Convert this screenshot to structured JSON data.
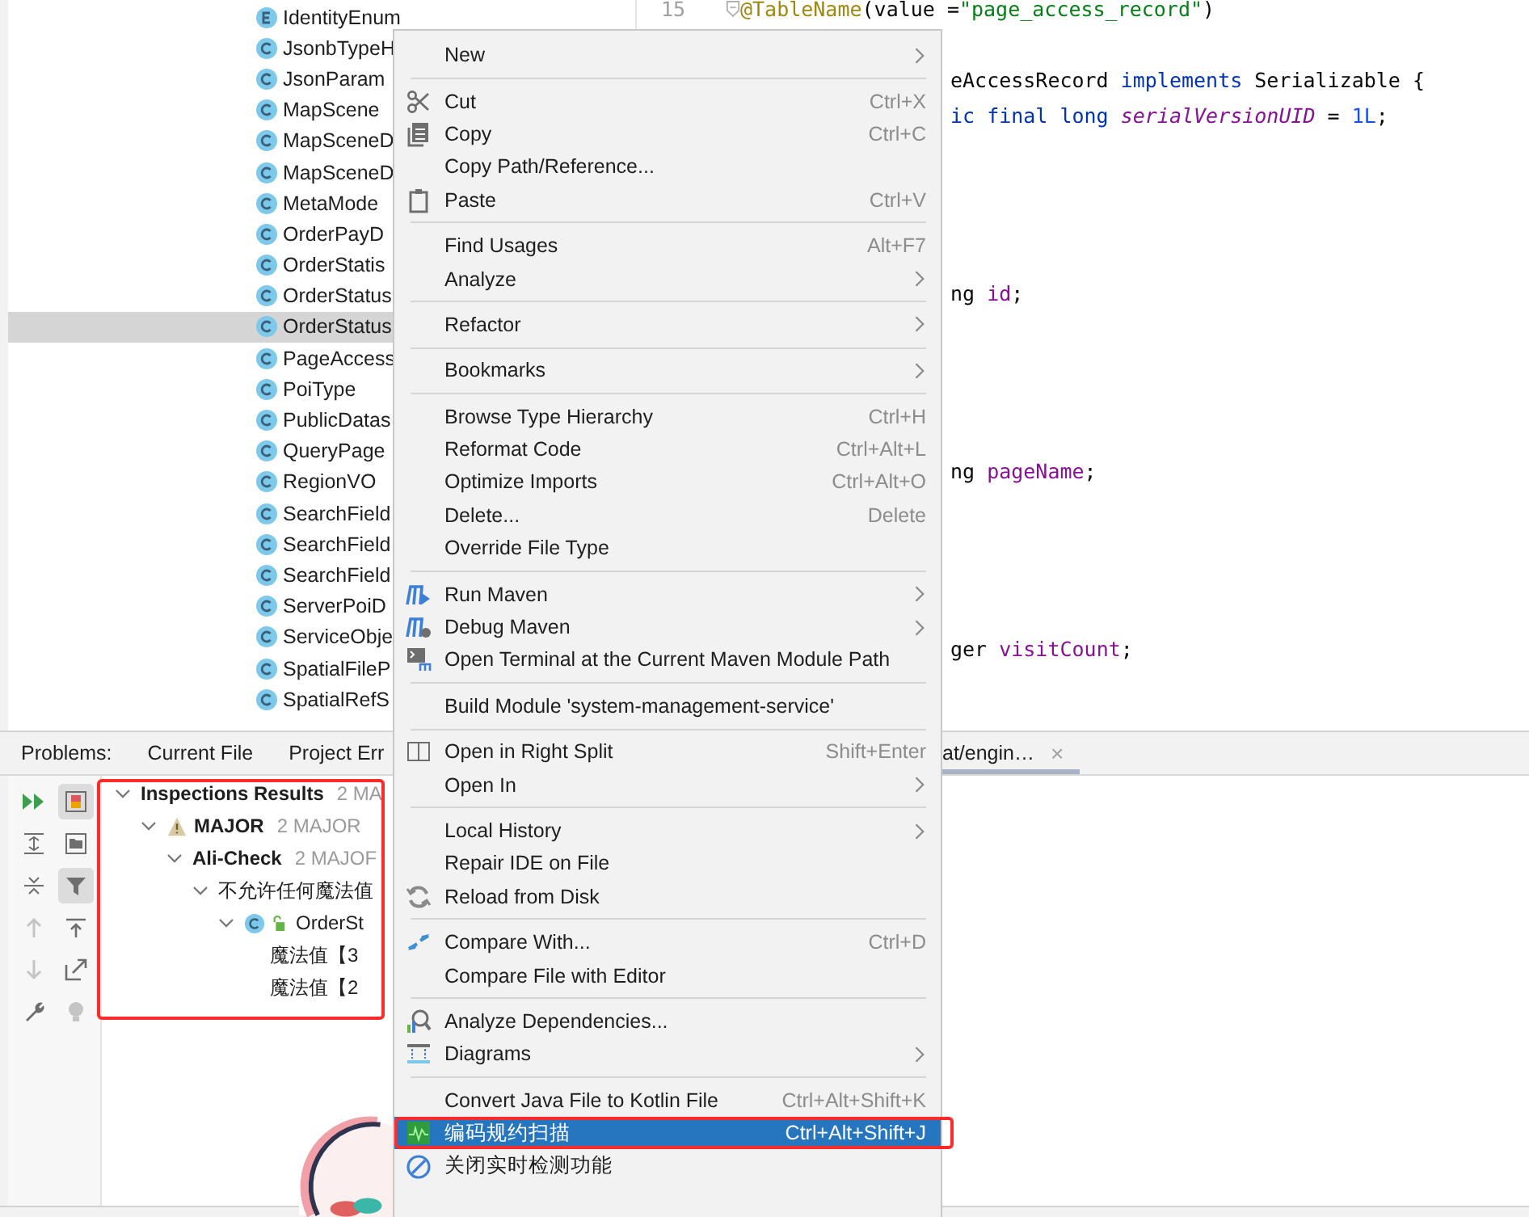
{
  "project_tree": {
    "items": [
      {
        "label": "IdentityEnum",
        "kind": "enum",
        "selected": false
      },
      {
        "label": "JsonbTypeH",
        "kind": "class",
        "selected": false
      },
      {
        "label": "JsonParam",
        "kind": "class",
        "selected": false
      },
      {
        "label": "MapScene",
        "kind": "class",
        "selected": false
      },
      {
        "label": "MapSceneD",
        "kind": "class",
        "selected": false
      },
      {
        "label": "MapSceneD",
        "kind": "class",
        "selected": false
      },
      {
        "label": "MetaMode",
        "kind": "class",
        "selected": false
      },
      {
        "label": "OrderPayD",
        "kind": "class",
        "selected": false
      },
      {
        "label": "OrderStatis",
        "kind": "class",
        "selected": false
      },
      {
        "label": "OrderStatus",
        "kind": "class",
        "selected": false
      },
      {
        "label": "OrderStatus",
        "kind": "class",
        "selected": true
      },
      {
        "label": "PageAccess",
        "kind": "class",
        "selected": false
      },
      {
        "label": "PoiType",
        "kind": "class",
        "selected": false
      },
      {
        "label": "PublicDatas",
        "kind": "class",
        "selected": false
      },
      {
        "label": "QueryPage",
        "kind": "class",
        "selected": false
      },
      {
        "label": "RegionVO",
        "kind": "class",
        "selected": false
      },
      {
        "label": "SearchField",
        "kind": "class",
        "selected": false
      },
      {
        "label": "SearchField",
        "kind": "class",
        "selected": false
      },
      {
        "label": "SearchField",
        "kind": "class",
        "selected": false
      },
      {
        "label": "ServerPoiD",
        "kind": "class",
        "selected": false
      },
      {
        "label": "ServiceObje",
        "kind": "class",
        "selected": false
      },
      {
        "label": "SpatialFileP",
        "kind": "class",
        "selected": false
      },
      {
        "label": "SpatialRefS",
        "kind": "class",
        "selected": false
      }
    ]
  },
  "editor": {
    "lines": [
      {
        "kind": "full",
        "number": "15",
        "tokens": [
          {
            "kind": "annotation",
            "text": "@TableName"
          },
          {
            "kind": "plain",
            "text": "(value ="
          },
          {
            "kind": "string",
            "text": "\"page_access_record\""
          },
          {
            "kind": "plain",
            "text": ")"
          }
        ]
      },
      {
        "kind": "blank"
      },
      {
        "kind": "partial",
        "tokens": [
          {
            "kind": "plain",
            "text": "eAccessRecord "
          },
          {
            "kind": "keyword",
            "text": "implements"
          },
          {
            "kind": "plain",
            "text": " Serializable {"
          }
        ]
      },
      {
        "kind": "partial",
        "tokens": [
          {
            "kind": "keyword",
            "text": "ic final long "
          },
          {
            "kind": "constant",
            "text": "serialVersionUID"
          },
          {
            "kind": "plain",
            "text": " = "
          },
          {
            "kind": "number",
            "text": "1L"
          },
          {
            "kind": "plain",
            "text": ";"
          }
        ]
      },
      {
        "kind": "blank"
      },
      {
        "kind": "blank"
      },
      {
        "kind": "blank"
      },
      {
        "kind": "blank"
      },
      {
        "kind": "partial",
        "tokens": [
          {
            "kind": "plain",
            "text": "ng "
          },
          {
            "kind": "field",
            "text": "id"
          },
          {
            "kind": "plain",
            "text": ";"
          }
        ]
      },
      {
        "kind": "blank"
      },
      {
        "kind": "blank"
      },
      {
        "kind": "blank"
      },
      {
        "kind": "blank"
      },
      {
        "kind": "partial",
        "tokens": [
          {
            "kind": "plain",
            "text": "ng "
          },
          {
            "kind": "field",
            "text": "pageName"
          },
          {
            "kind": "plain",
            "text": ";"
          }
        ]
      },
      {
        "kind": "blank"
      },
      {
        "kind": "blank"
      },
      {
        "kind": "blank"
      },
      {
        "kind": "blank"
      },
      {
        "kind": "partial",
        "tokens": [
          {
            "kind": "plain",
            "text": "ger "
          },
          {
            "kind": "field",
            "text": "visitCount"
          },
          {
            "kind": "plain",
            "text": ";"
          }
        ]
      }
    ]
  },
  "problems_panel": {
    "label": "Problems:",
    "tabs": [
      {
        "label": "Current File",
        "selected": false
      },
      {
        "label": "Project Err",
        "selected": false
      }
    ],
    "open_tab": {
      "label": "at/engin…",
      "selected": true,
      "close": "×"
    },
    "toolbar": [
      {
        "kind": "run",
        "on": false,
        "disabled": false
      },
      {
        "kind": "severity",
        "on": true,
        "disabled": false
      },
      {
        "kind": "expand",
        "on": false,
        "disabled": false
      },
      {
        "kind": "folder",
        "on": false,
        "disabled": false
      },
      {
        "kind": "collapse",
        "on": false,
        "disabled": false
      },
      {
        "kind": "filter",
        "on": true,
        "disabled": false
      },
      {
        "kind": "up",
        "on": false,
        "disabled": true
      },
      {
        "kind": "export",
        "on": false,
        "disabled": false
      },
      {
        "kind": "down",
        "on": false,
        "disabled": true
      },
      {
        "kind": "open",
        "on": false,
        "disabled": false
      },
      {
        "kind": "wrench",
        "on": false,
        "disabled": false
      },
      {
        "kind": "bulb",
        "on": false,
        "disabled": true
      }
    ],
    "tree": [
      {
        "label": "Inspections Results",
        "count": "2 MA",
        "bold": true,
        "expanded": true,
        "children": [
          {
            "label": "MAJOR",
            "count": "2 MAJOR",
            "bold": true,
            "kind": "warning",
            "expanded": true,
            "children": [
              {
                "label": "Ali-Check",
                "count": "2 MAJOF",
                "bold": true,
                "expanded": true,
                "children": [
                  {
                    "label": "不允许任何魔法值",
                    "bold": false,
                    "expanded": true,
                    "children": [
                      {
                        "label": "OrderSt",
                        "bold": false,
                        "kind": "class",
                        "expanded": true,
                        "children": [
                          {
                            "label": "魔法值【3",
                            "bold": false
                          },
                          {
                            "label": "魔法值【2",
                            "bold": false
                          }
                        ]
                      }
                    ]
                  }
                ]
              }
            ]
          }
        ]
      }
    ]
  },
  "context_menu": {
    "groups": [
      [
        {
          "label": "New",
          "submenu": true
        }
      ],
      [
        {
          "label": "Cut",
          "kind": "scissors",
          "shortcut": "Ctrl+X"
        },
        {
          "label": "Copy",
          "kind": "copy",
          "shortcut": "Ctrl+C"
        },
        {
          "label": "Copy Path/Reference..."
        },
        {
          "label": "Paste",
          "kind": "paste",
          "shortcut": "Ctrl+V"
        }
      ],
      [
        {
          "label": "Find Usages",
          "shortcut": "Alt+F7"
        },
        {
          "label": "Analyze",
          "submenu": true
        }
      ],
      [
        {
          "label": "Refactor",
          "submenu": true
        }
      ],
      [
        {
          "label": "Bookmarks",
          "submenu": true
        }
      ],
      [
        {
          "label": "Browse Type Hierarchy",
          "shortcut": "Ctrl+H"
        },
        {
          "label": "Reformat Code",
          "shortcut": "Ctrl+Alt+L"
        },
        {
          "label": "Optimize Imports",
          "shortcut": "Ctrl+Alt+O"
        },
        {
          "label": "Delete...",
          "shortcut": "Delete"
        },
        {
          "label": "Override File Type"
        }
      ],
      [
        {
          "label": "Run Maven",
          "kind": "maven-run",
          "submenu": true
        },
        {
          "label": "Debug Maven",
          "kind": "maven-debug",
          "submenu": true
        },
        {
          "label": "Open Terminal at the Current Maven Module Path",
          "kind": "terminal"
        }
      ],
      [
        {
          "label": "Build Module 'system-management-service'"
        }
      ],
      [
        {
          "label": "Open in Right Split",
          "kind": "split",
          "shortcut": "Shift+Enter"
        },
        {
          "label": "Open In",
          "submenu": true
        }
      ],
      [
        {
          "label": "Local History",
          "submenu": true
        },
        {
          "label": "Repair IDE on File"
        },
        {
          "label": "Reload from Disk",
          "kind": "reload"
        }
      ],
      [
        {
          "label": "Compare With...",
          "kind": "compare",
          "shortcut": "Ctrl+D"
        },
        {
          "label": "Compare File with Editor"
        }
      ],
      [
        {
          "label": "Analyze Dependencies...",
          "kind": "dependencies"
        },
        {
          "label": "Diagrams",
          "kind": "diagrams",
          "submenu": true
        }
      ],
      [
        {
          "label": "Convert Java File to Kotlin File",
          "shortcut": "Ctrl+Alt+Shift+K"
        },
        {
          "label": "编码规约扫描",
          "kind": "scan",
          "shortcut": "Ctrl+Alt+Shift+J",
          "selected": true
        },
        {
          "label": "关闭实时检测功能",
          "kind": "disable"
        }
      ]
    ]
  }
}
